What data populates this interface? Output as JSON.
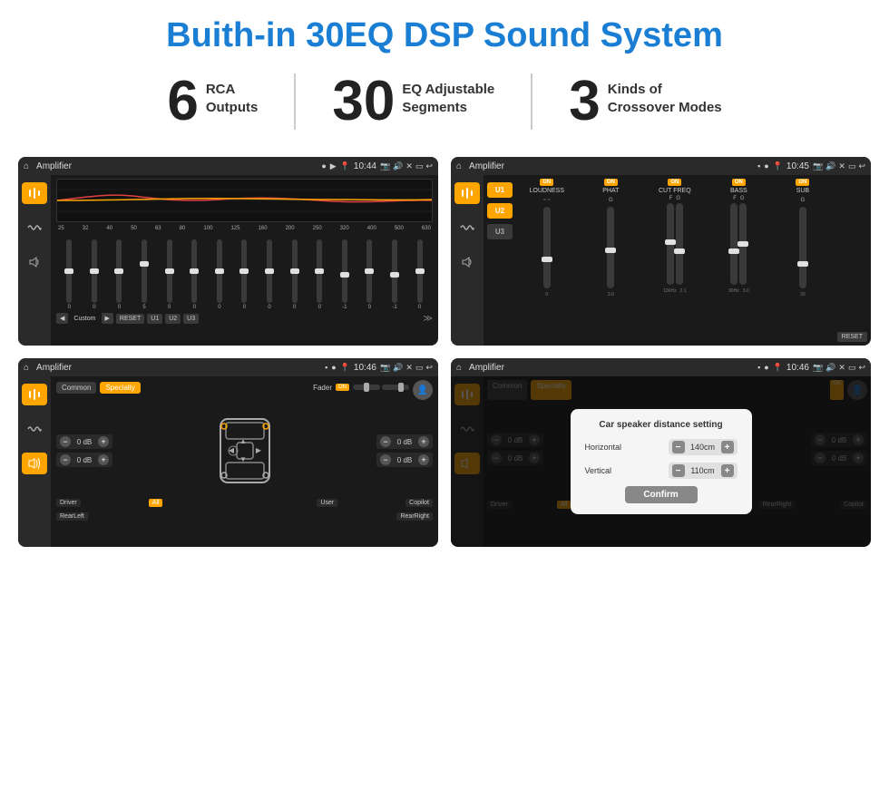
{
  "header": {
    "title": "Buith-in 30EQ DSP Sound System"
  },
  "stats": [
    {
      "number": "6",
      "label": "RCA\nOutputs"
    },
    {
      "number": "30",
      "label": "EQ Adjustable\nSegments"
    },
    {
      "number": "3",
      "label": "Kinds of\nCrossover Modes"
    }
  ],
  "screens": [
    {
      "id": "screen1",
      "status_bar": {
        "title": "Amplifier",
        "time": "10:44"
      },
      "type": "eq"
    },
    {
      "id": "screen2",
      "status_bar": {
        "title": "Amplifier",
        "time": "10:45"
      },
      "type": "amp2"
    },
    {
      "id": "screen3",
      "status_bar": {
        "title": "Amplifier",
        "time": "10:46"
      },
      "type": "common-specialty"
    },
    {
      "id": "screen4",
      "status_bar": {
        "title": "Amplifier",
        "time": "10:46"
      },
      "type": "dialog"
    }
  ],
  "eq": {
    "freqs": [
      "25",
      "32",
      "40",
      "50",
      "63",
      "80",
      "100",
      "125",
      "160",
      "200",
      "250",
      "320",
      "400",
      "500",
      "630"
    ],
    "values": [
      "0",
      "0",
      "0",
      "5",
      "0",
      "0",
      "0",
      "0",
      "0",
      "0",
      "0",
      "-1",
      "0",
      "-1",
      "0"
    ],
    "buttons": [
      "Custom",
      "RESET",
      "U1",
      "U2",
      "U3"
    ]
  },
  "amp2": {
    "u_buttons": [
      "U1",
      "U2",
      "U3"
    ],
    "channels": [
      "LOUDNESS",
      "PHAT",
      "CUT FREQ",
      "BASS",
      "SUB"
    ],
    "reset": "RESET"
  },
  "screen3": {
    "tabs": [
      "Common",
      "Specialty"
    ],
    "fader_label": "Fader",
    "on_label": "ON",
    "db_values": [
      "0 dB",
      "0 dB",
      "0 dB",
      "0 dB"
    ],
    "bottom_labels": [
      "Driver",
      "All",
      "User",
      "RearLeft",
      "RearRight",
      "Copilot"
    ]
  },
  "dialog": {
    "title": "Car speaker distance setting",
    "horizontal_label": "Horizontal",
    "horizontal_value": "140cm",
    "vertical_label": "Vertical",
    "vertical_value": "110cm",
    "confirm_label": "Confirm",
    "db_right_values": [
      "0 dB",
      "0 dB"
    ],
    "copilot_label": "Copilot",
    "driver_label": "Driver",
    "rearLeft_label": "RearLeft",
    "rearRight_label": "RearRight",
    "all_label": "All",
    "user_label": "User"
  }
}
